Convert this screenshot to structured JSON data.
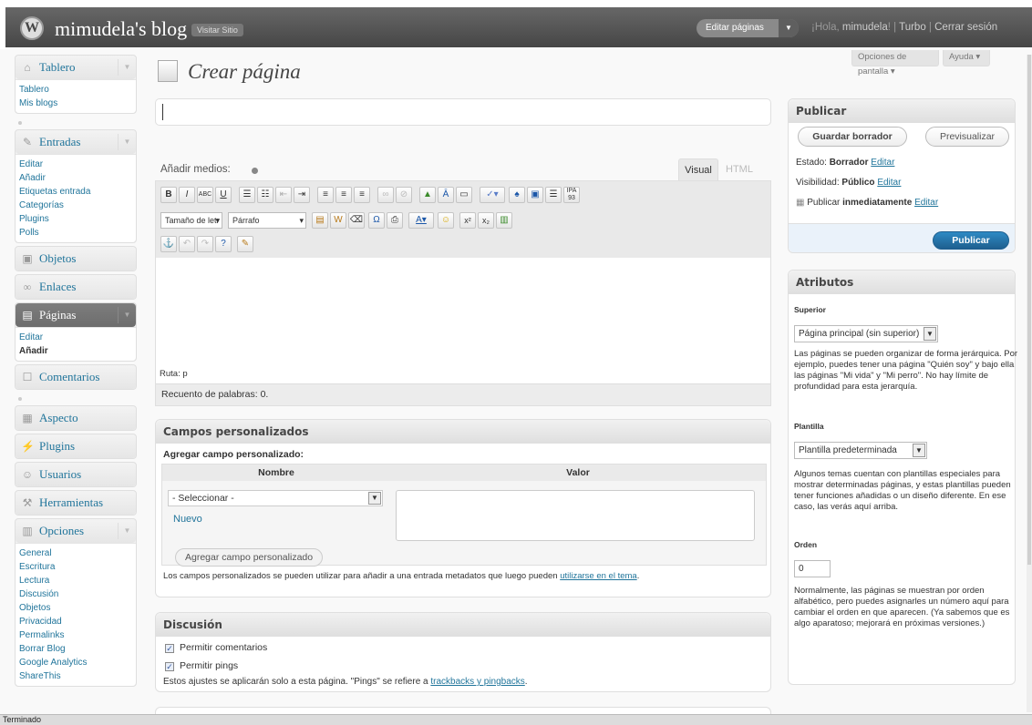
{
  "header": {
    "site_title": "mimudela's blog",
    "visit_site": "Visitar Sitio",
    "favorite_action": "Editar páginas",
    "greeting_prefix": "¡Hola, ",
    "username": "mimudela",
    "greeting_suffix": "! | ",
    "turbo": "Turbo",
    "sep": " | ",
    "logout": "Cerrar sesión"
  },
  "screen_options": "Opciones de pantalla",
  "help": "Ayuda",
  "menu": {
    "dashboard": {
      "label": "Tablero",
      "items": [
        "Tablero",
        "Mis blogs"
      ]
    },
    "posts": {
      "label": "Entradas",
      "items": [
        "Editar",
        "Añadir",
        "Etiquetas entrada",
        "Categorías",
        "Plugins",
        "Polls"
      ]
    },
    "media": {
      "label": "Objetos"
    },
    "links": {
      "label": "Enlaces"
    },
    "pages": {
      "label": "Páginas",
      "items": [
        "Editar",
        "Añadir"
      ]
    },
    "comments": {
      "label": "Comentarios"
    },
    "appearance": {
      "label": "Aspecto"
    },
    "plugins": {
      "label": "Plugins"
    },
    "users": {
      "label": "Usuarios"
    },
    "tools": {
      "label": "Herramientas"
    },
    "settings": {
      "label": "Opciones",
      "items": [
        "General",
        "Escritura",
        "Lectura",
        "Discusión",
        "Objetos",
        "Privacidad",
        "Permalinks",
        "Borrar Blog",
        "Google Analytics",
        "ShareThis"
      ]
    }
  },
  "page_title": "Crear página",
  "editor": {
    "add_media": "Añadir medios:",
    "tab_visual": "Visual",
    "tab_html": "HTML",
    "font_size_select": "Tamaño de letr",
    "format_select": "Párrafo",
    "path": "Ruta: p",
    "word_count": "Recuento de palabras: 0."
  },
  "custom_fields": {
    "title": "Campos personalizados",
    "add_label": "Agregar campo personalizado:",
    "col_name": "Nombre",
    "col_value": "Valor",
    "select_value": "- Seleccionar -",
    "new_link": "Nuevo",
    "add_button": "Agregar campo personalizado",
    "note": "Los campos personalizados se pueden utilizar para añadir a una entrada metadatos que luego pueden ",
    "note_link": "utilizarse en el tema",
    "note_end": "."
  },
  "discussion": {
    "title": "Discusión",
    "allow_comments": "Permitir comentarios",
    "allow_pings": "Permitir pings",
    "note": "Estos ajustes se aplicarán solo a esta página. \"Pings\" se refiere a ",
    "note_link": "trackbacks y pingbacks",
    "note_end": "."
  },
  "publish": {
    "title": "Publicar",
    "save_draft": "Guardar borrador",
    "preview": "Previsualizar",
    "status_label": "Estado: ",
    "status_value": "Borrador",
    "visibility_label": "Visibilidad: ",
    "visibility_value": "Público",
    "publish_prefix": "Publicar ",
    "publish_when": "inmediatamente",
    "edit": "Editar",
    "publish_button": "Publicar"
  },
  "attributes": {
    "title": "Atributos",
    "parent_label": "Superior",
    "parent_value": "Página principal (sin superior)",
    "parent_help": "Las páginas se pueden organizar de forma jerárquica. Por ejemplo, puedes tener una página \"Quién soy\" y bajo ella las páginas \"Mi vida\" y \"Mi perro\". No hay límite de profundidad para esta jerarquía.",
    "template_label": "Plantilla",
    "template_value": "Plantilla predeterminada",
    "template_help": "Algunos temas cuentan con plantillas especiales para mostrar determinadas páginas, y estas plantillas pueden tener funciones añadidas o un diseño diferente. En ese caso, las verás aquí arriba.",
    "order_label": "Orden",
    "order_value": "0",
    "order_help": "Normalmente, las páginas se muestran por orden alfabético, pero puedes asignarles un número aquí para cambiar el orden en que aparecen. (Ya sabemos que es algo aparatoso; mejorará en próximas versiones.)"
  },
  "statusbar": "Terminado"
}
